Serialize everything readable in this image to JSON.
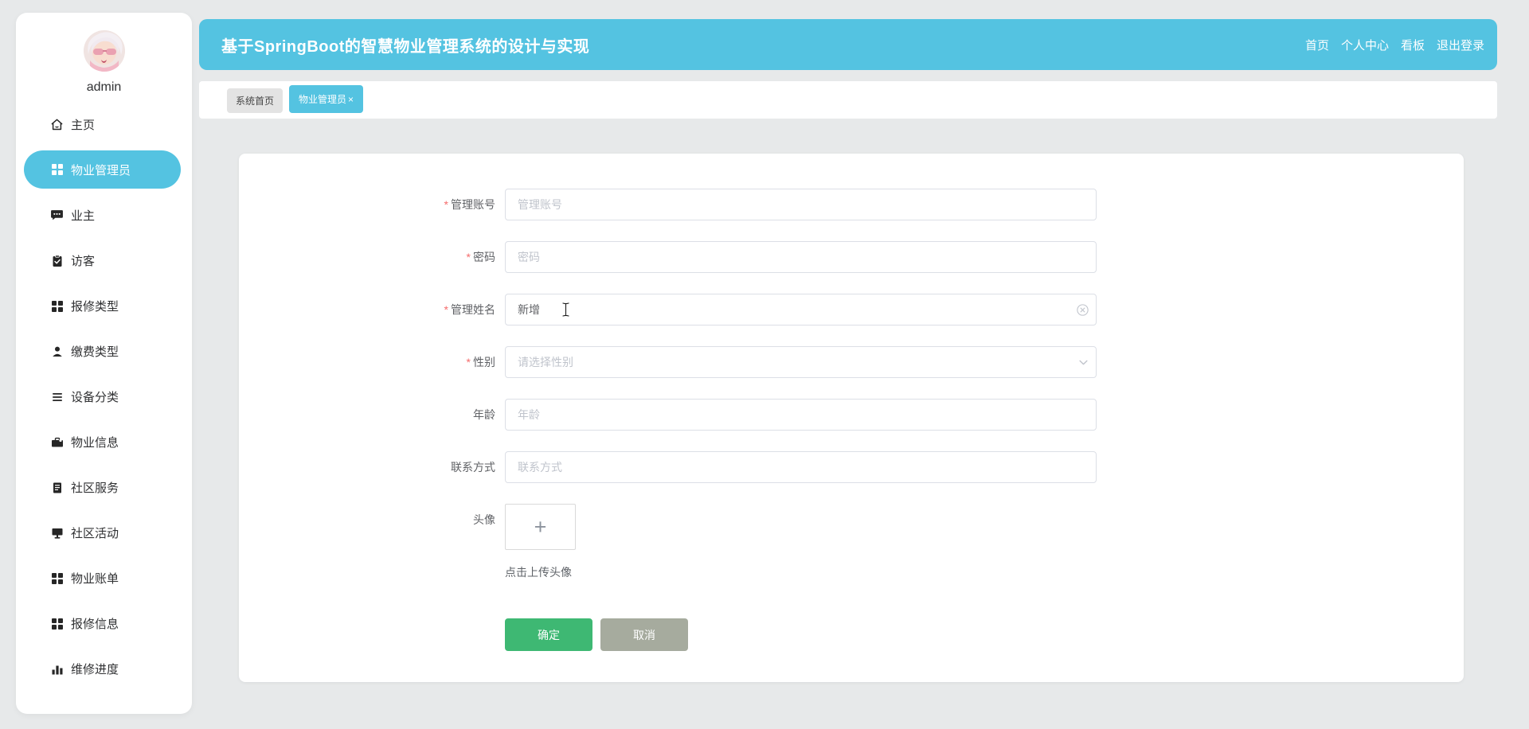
{
  "user": {
    "name": "admin"
  },
  "sidebar": {
    "items": [
      {
        "label": "主页",
        "icon": "home-icon",
        "active": false
      },
      {
        "label": "物业管理员",
        "icon": "grid-icon",
        "active": true
      },
      {
        "label": "业主",
        "icon": "chat-icon",
        "active": false
      },
      {
        "label": "访客",
        "icon": "clipboard-check-icon",
        "active": false
      },
      {
        "label": "报修类型",
        "icon": "grid-icon",
        "active": false
      },
      {
        "label": "缴费类型",
        "icon": "user-icon",
        "active": false
      },
      {
        "label": "设备分类",
        "icon": "list-icon",
        "active": false
      },
      {
        "label": "物业信息",
        "icon": "briefcase-icon",
        "active": false
      },
      {
        "label": "社区服务",
        "icon": "document-icon",
        "active": false
      },
      {
        "label": "社区活动",
        "icon": "monitor-icon",
        "active": false
      },
      {
        "label": "物业账单",
        "icon": "grid-icon",
        "active": false
      },
      {
        "label": "报修信息",
        "icon": "grid-icon",
        "active": false
      },
      {
        "label": "维修进度",
        "icon": "bar-chart-icon",
        "active": false
      }
    ]
  },
  "header": {
    "title": "基于SpringBoot的智慧物业管理系统的设计与实现",
    "nav": [
      {
        "label": "首页"
      },
      {
        "label": "个人中心"
      },
      {
        "label": "看板"
      },
      {
        "label": "退出登录"
      }
    ]
  },
  "tabs": [
    {
      "label": "系统首页",
      "active": false,
      "closable": false
    },
    {
      "label": "物业管理员",
      "active": true,
      "closable": true,
      "close_glyph": "×"
    }
  ],
  "form": {
    "required_mark": "*",
    "fields": [
      {
        "label": "管理账号",
        "required": true,
        "type": "text",
        "placeholder": "管理账号",
        "value": ""
      },
      {
        "label": "密码",
        "required": true,
        "type": "text",
        "placeholder": "密码",
        "value": ""
      },
      {
        "label": "管理姓名",
        "required": true,
        "type": "text",
        "placeholder": "",
        "value": "新增",
        "clearable": true
      },
      {
        "label": "性别",
        "required": true,
        "type": "select",
        "placeholder": "请选择性别",
        "value": ""
      },
      {
        "label": "年龄",
        "required": false,
        "type": "text",
        "placeholder": "年龄",
        "value": ""
      },
      {
        "label": "联系方式",
        "required": false,
        "type": "text",
        "placeholder": "联系方式",
        "value": ""
      }
    ],
    "avatar_field": {
      "label": "头像",
      "plus_glyph": "+",
      "hint": "点击上传头像"
    },
    "buttons": {
      "confirm": "确定",
      "cancel": "取消"
    }
  },
  "colors": {
    "accent_cyan": "#54c3e1",
    "confirm_green": "#3eb873",
    "cancel_gray": "#a6ab9e",
    "required_red": "#f56c6c",
    "placeholder_gray": "#c0c4cc",
    "input_border": "#dcdfe6"
  }
}
